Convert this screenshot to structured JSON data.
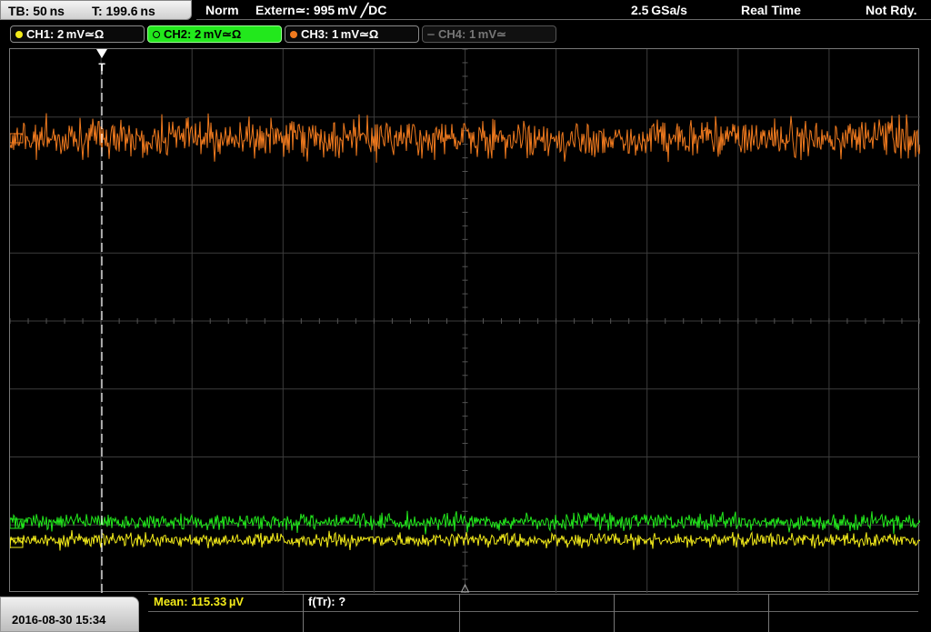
{
  "top": {
    "timebase": "TB: 50 ns",
    "trigger_time": "T: 199.6 ns",
    "mode": "Norm",
    "trigger": "Extern≃: 995 mV ╱DC",
    "sample_rate": "2.5 GSa/s",
    "acquisition": "Real Time",
    "status": "Not Rdy."
  },
  "channels": [
    {
      "label": "CH1: 2 mV≃Ω",
      "color": "#f2ea1a",
      "state": "on"
    },
    {
      "label": "CH2: 2 mV≃Ω",
      "color": "#22e81c",
      "state": "selected"
    },
    {
      "label": "CH3: 1 mV≃Ω",
      "color": "#f07a1e",
      "state": "on"
    },
    {
      "label": "CH4: 1 mV≃",
      "color": "#777777",
      "state": "off"
    }
  ],
  "bottom": {
    "datetime": "2016-08-30 15:34",
    "measurement": "Mean: 115.33 µV",
    "measurement_color": "#f2ea1a",
    "freq": "f(Tr): ?"
  },
  "markers": {
    "trigger_marker": "T"
  }
}
